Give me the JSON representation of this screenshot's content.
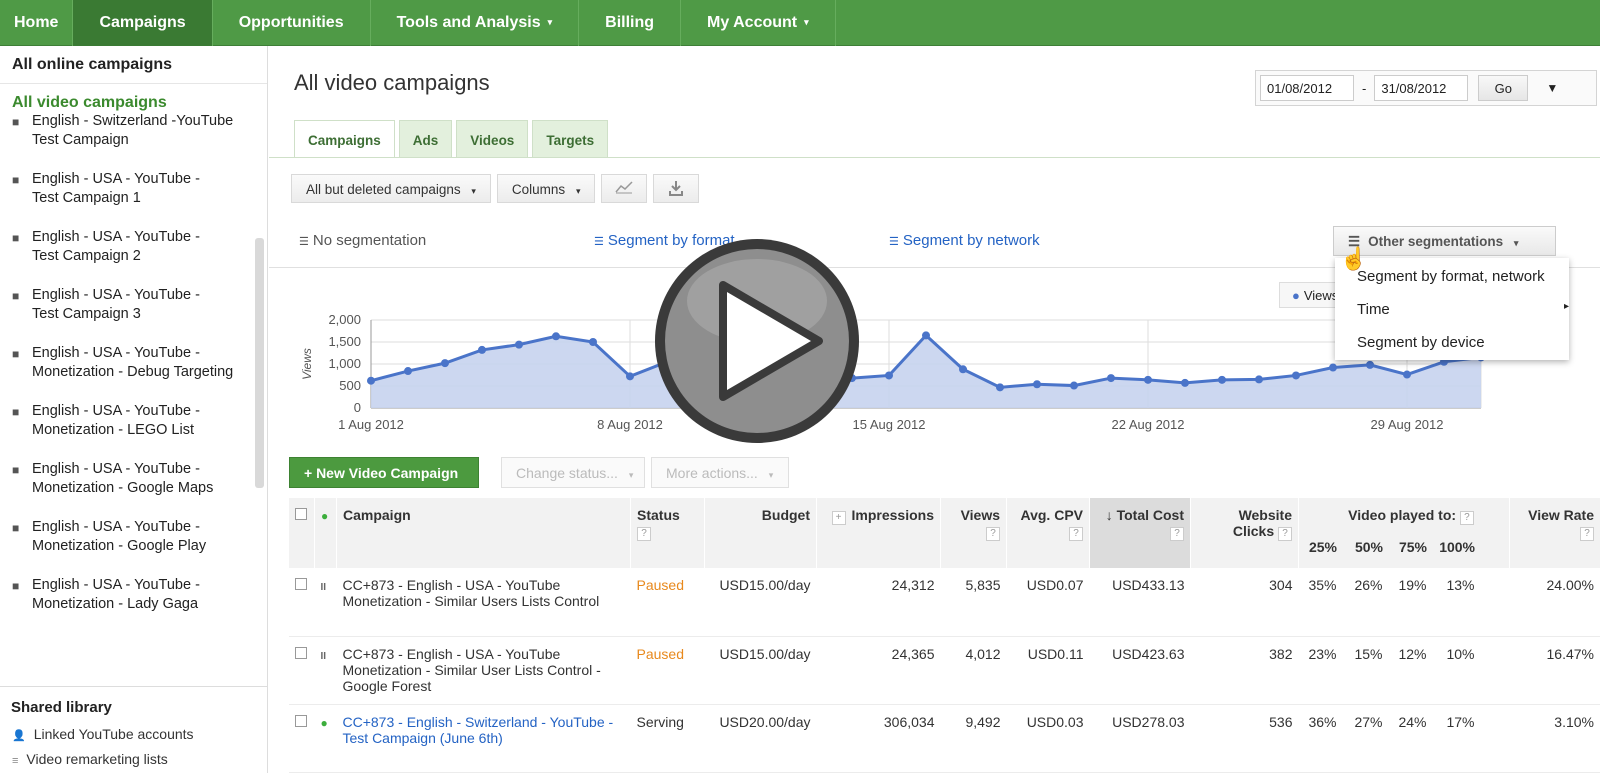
{
  "nav": {
    "items": [
      {
        "label": "Home"
      },
      {
        "label": "Campaigns"
      },
      {
        "label": "Opportunities"
      },
      {
        "label": "Tools and Analysis",
        "caret": "▾"
      },
      {
        "label": "Billing"
      },
      {
        "label": "My Account",
        "caret": "▾"
      }
    ]
  },
  "sidebar": {
    "all_online": "All online campaigns",
    "all_video": "All video campaigns",
    "campaigns": [
      {
        "l1": "English - Switzerland -YouTube",
        "l2": "Test Campaign"
      },
      {
        "l1": "English - USA - YouTube -",
        "l2": "Test Campaign 1"
      },
      {
        "l1": "English - USA - YouTube -",
        "l2": "Test Campaign 2"
      },
      {
        "l1": "English - USA - YouTube -",
        "l2": "Test Campaign 3"
      },
      {
        "l1": "English - USA - YouTube -",
        "l2": "Monetization - Debug Targeting"
      },
      {
        "l1": "English - USA - YouTube -",
        "l2": "Monetization - LEGO List"
      },
      {
        "l1": "English - USA - YouTube -",
        "l2": "Monetization - Google Maps"
      },
      {
        "l1": "English - USA - YouTube -",
        "l2": "Monetization - Google Play"
      },
      {
        "l1": "English - USA - YouTube -",
        "l2": "Monetization - Lady Gaga"
      }
    ],
    "shared_library": "Shared library",
    "linked_accounts": "Linked YouTube accounts",
    "remarketing": "Video remarketing lists"
  },
  "page": {
    "title": "All video campaigns"
  },
  "daterange": {
    "start": "01/08/2012",
    "end": "31/08/2012",
    "sep": "-",
    "go": "Go"
  },
  "tabs": [
    {
      "label": "Campaigns"
    },
    {
      "label": "Ads"
    },
    {
      "label": "Videos"
    },
    {
      "label": "Targets"
    }
  ],
  "toolbar": {
    "filter": "All but deleted campaigns",
    "columns": "Columns"
  },
  "segments": {
    "none": "No segmentation",
    "by_format": "Segment by format",
    "by_network": "Segment by network",
    "other": "Other segmentations",
    "menu": [
      "Segment by format, network",
      "Time",
      "Segment by device"
    ]
  },
  "chart_data": {
    "type": "area",
    "ylabel": "Views",
    "yticks": [
      "2,000",
      "1,500",
      "1,000",
      "500",
      "0"
    ],
    "ylim": [
      0,
      2000
    ],
    "xticks": [
      "1 Aug 2012",
      "8 Aug 2012",
      "15 Aug 2012",
      "22 Aug 2012",
      "29 Aug 2012"
    ],
    "legend": "Views",
    "series": [
      {
        "name": "Views",
        "values": [
          620,
          840,
          1020,
          1320,
          1440,
          1630,
          1500,
          720,
          1050,
          1100,
          1000,
          900,
          800,
          680,
          740,
          1650,
          880,
          470,
          540,
          510,
          680,
          640,
          570,
          640,
          650,
          740,
          920,
          980,
          760,
          1050,
          1150
        ]
      }
    ]
  },
  "actions": {
    "new_campaign": "+ New Video Campaign",
    "change_status": "Change status...",
    "more_actions": "More actions..."
  },
  "table": {
    "headers": {
      "campaign": "Campaign",
      "status": "Status",
      "budget": "Budget",
      "impressions": "Impressions",
      "views": "Views",
      "cpv": "Avg. CPV",
      "total_cost": "Total Cost",
      "website_clicks": "Website Clicks",
      "video_played": "Video played to:",
      "p25": "25%",
      "p50": "50%",
      "p75": "75%",
      "p100": "100%",
      "view_rate": "View Rate",
      "q": "?",
      "plus": "+"
    },
    "rows": [
      {
        "campaign": "CC+873 - English - USA - YouTube Monetization - Similar Users Lists Control",
        "status": "Paused",
        "budget": "USD15.00/day",
        "impressions": "24,312",
        "views": "5,835",
        "cpv": "USD0.07",
        "cost": "USD433.13",
        "clicks": "304",
        "p25": "35%",
        "p50": "26%",
        "p75": "19%",
        "p100": "13%",
        "rate": "24.00%"
      },
      {
        "campaign": "CC+873 - English - USA - YouTube Monetization - Similar User Lists Control - Google Forest",
        "status": "Paused",
        "budget": "USD15.00/day",
        "impressions": "24,365",
        "views": "4,012",
        "cpv": "USD0.11",
        "cost": "USD423.63",
        "clicks": "382",
        "p25": "23%",
        "p50": "15%",
        "p75": "12%",
        "p100": "10%",
        "rate": "16.47%"
      },
      {
        "campaign": "CC+873 - English - Switzerland - YouTube - Test Campaign (June 6th)",
        "status": "Serving",
        "budget": "USD20.00/day",
        "impressions": "306,034",
        "views": "9,492",
        "cpv": "USD0.03",
        "cost": "USD278.03",
        "clicks": "536",
        "p25": "36%",
        "p50": "27%",
        "p75": "24%",
        "p100": "17%",
        "rate": "3.10%"
      }
    ]
  },
  "colors": {
    "nav_green": "#4f9a46",
    "accent_blue": "#2463c4",
    "paused_orange": "#e8891d",
    "series_blue": "#4a74c9"
  }
}
